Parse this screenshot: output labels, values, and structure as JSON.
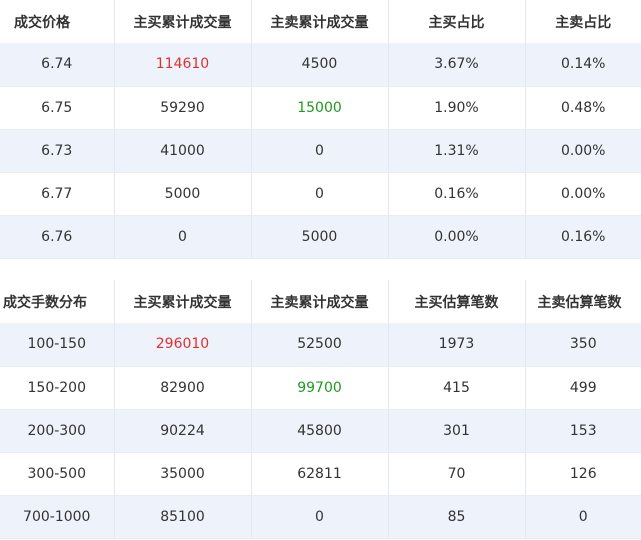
{
  "colors": {
    "red": "#e03030",
    "green": "#1f9a1f",
    "row_alt": "#eef3fb"
  },
  "price_table": {
    "headers": [
      "成交价格",
      "主买累计成交量",
      "主卖累计成交量",
      "主买占比",
      "主卖占比"
    ],
    "rows": [
      [
        "6.74",
        "114610",
        "4500",
        "3.67%",
        "0.14%"
      ],
      [
        "6.75",
        "59290",
        "15000",
        "1.90%",
        "0.48%"
      ],
      [
        "6.73",
        "41000",
        "0",
        "1.31%",
        "0.00%"
      ],
      [
        "6.77",
        "5000",
        "0",
        "0.16%",
        "0.00%"
      ],
      [
        "6.76",
        "0",
        "5000",
        "0.00%",
        "0.16%"
      ]
    ]
  },
  "lot_table": {
    "headers": [
      "成交手数分布",
      "主买累计成交量",
      "主卖累计成交量",
      "主买估算笔数",
      "主卖估算笔数"
    ],
    "rows": [
      [
        "100-150",
        "296010",
        "52500",
        "1973",
        "350"
      ],
      [
        "150-200",
        "82900",
        "99700",
        "415",
        "499"
      ],
      [
        "200-300",
        "90224",
        "45800",
        "301",
        "153"
      ],
      [
        "300-500",
        "35000",
        "62811",
        "70",
        "126"
      ],
      [
        "700-1000",
        "85100",
        "0",
        "85",
        "0"
      ]
    ]
  }
}
